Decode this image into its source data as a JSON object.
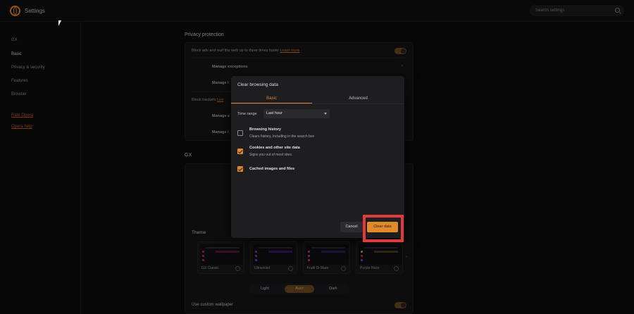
{
  "app": {
    "title": "Settings"
  },
  "search": {
    "placeholder": "Search settings"
  },
  "sidebar": {
    "items": [
      {
        "label": "GX"
      },
      {
        "label": "Basic"
      },
      {
        "label": "Privacy & security"
      },
      {
        "label": "Features"
      },
      {
        "label": "Browser"
      }
    ],
    "links": [
      {
        "label": "Rate Opera"
      },
      {
        "label": "Opera help"
      }
    ]
  },
  "privacy": {
    "section_title": "Privacy protection",
    "block_ads_text": "Block ads and surf the web up to three times faster",
    "learn_more": "Learn more",
    "manage_exceptions": "Manage exceptions",
    "manage_lists_partial": "Manage l",
    "block_trackers": "Block trackers",
    "learn_partial": "Lea",
    "manage_e_partial": "Manage e",
    "manage_l_partial": "Manage l"
  },
  "gx": {
    "section_title": "GX",
    "theme_label": "Theme",
    "themes": [
      {
        "name": "GX Classic"
      },
      {
        "name": "Ultraviolet"
      },
      {
        "name": "Frutti Di Mare"
      },
      {
        "name": "Purple Haze"
      }
    ],
    "modes": [
      "Light",
      "Auto",
      "Dark"
    ],
    "custom_wallpaper": "Use custom wallpaper"
  },
  "dialog": {
    "title": "Clear browsing data",
    "tabs": [
      "Basic",
      "Advanced"
    ],
    "time_range_label": "Time range",
    "time_range_value": "Last hour",
    "options": [
      {
        "title": "Browsing history",
        "desc": "Clears history, including in the search box",
        "checked": false
      },
      {
        "title": "Cookies and other site data",
        "desc": "Signs you out of most sites.",
        "checked": true
      },
      {
        "title": "Cached images and files",
        "desc": "",
        "checked": true
      }
    ],
    "cancel_label": "Cancel",
    "clear_label": "Clear data"
  },
  "colors": {
    "accent": "#e08a2a",
    "highlight": "#e03a3a"
  }
}
